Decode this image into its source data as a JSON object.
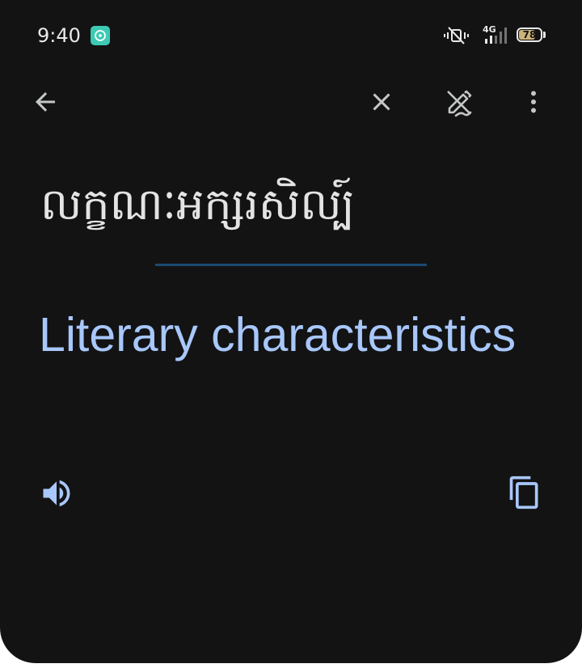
{
  "status_bar": {
    "time": "9:40",
    "network": "4G",
    "battery": "78",
    "battery_percent": 78,
    "app_icon": "music-app-icon",
    "icons": [
      "vibrate-silent-icon",
      "signal-icon",
      "battery-icon"
    ]
  },
  "toolbar": {
    "back_icon": "arrow-back-icon",
    "clear_icon": "close-icon",
    "handwrite_icon": "edit-off-icon",
    "menu_icon": "more-vert-icon"
  },
  "source": {
    "text": "លក្ខណៈអក្សរសិល្ប៍"
  },
  "translation": {
    "text": "Literary characteristics",
    "listen_icon": "volume-up-icon",
    "copy_icon": "copy-icon"
  },
  "colors": {
    "background": "#131314",
    "source_text": "#e3e3e3",
    "translation_text": "#a8c7fa",
    "divider": "#1b4a72",
    "icon": "#c4c7c5",
    "accent_icon": "#a8c7fa",
    "app_icon": "#3ccab4"
  }
}
